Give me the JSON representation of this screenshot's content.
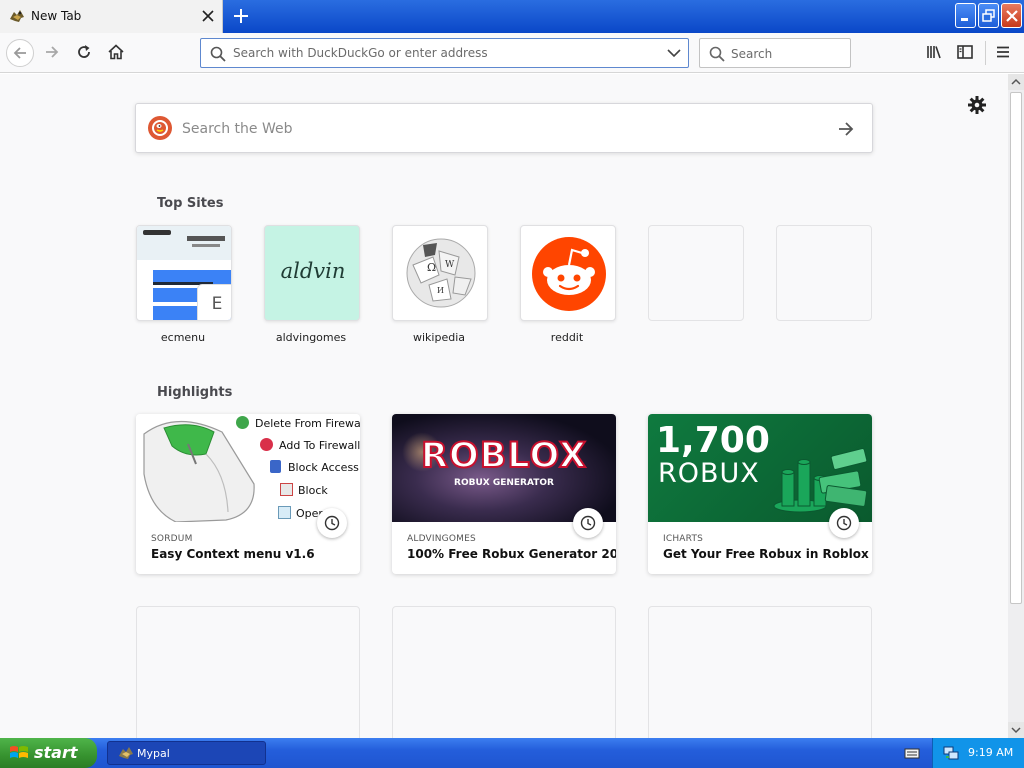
{
  "browser": {
    "tab": {
      "title": "New Tab",
      "favicon": "mypal-icon"
    },
    "window_controls": [
      "minimize-icon",
      "maximize-icon",
      "close-icon"
    ]
  },
  "toolbar": {
    "url_placeholder": "Search with DuckDuckGo or enter address",
    "url_value": "",
    "search_placeholder": "Search"
  },
  "newtab": {
    "web_search_placeholder": "Search the Web",
    "top_sites_title": "Top Sites",
    "top_sites": [
      {
        "label": "ecmenu",
        "badge": "E"
      },
      {
        "label": "aldvingomes",
        "tile_text": "aldvin"
      },
      {
        "label": "wikipedia"
      },
      {
        "label": "reddit"
      },
      {
        "label": ""
      },
      {
        "label": ""
      }
    ],
    "highlights_title": "Highlights",
    "highlights": [
      {
        "source": "SORDUM",
        "title": "Easy Context menu v1.6",
        "menu_items": [
          "Delete From Firewall",
          "Add To Firewall",
          "Block Access",
          "Block",
          "Open"
        ]
      },
      {
        "source": "ALDVINGOMES",
        "title": "100% Free Robux Generator 20...",
        "image_title": "ROBLOX",
        "image_subtitle": "ROBUX GENERATOR"
      },
      {
        "source": "ICHARTS",
        "title": "Get Your Free Robux in Roblox ...",
        "image_amount": "1,700",
        "image_unit": "ROBUX"
      }
    ]
  },
  "taskbar": {
    "start_label": "start",
    "task_label": "Mypal",
    "clock": "9:19 AM"
  },
  "colors": {
    "xp_blue": "#245edb",
    "start_green": "#36922f",
    "reddit_orange": "#ff4500",
    "ddg_orange": "#de5833",
    "aldvin_mint": "#c5f3e4",
    "robux_green": "#0f7a3f"
  }
}
